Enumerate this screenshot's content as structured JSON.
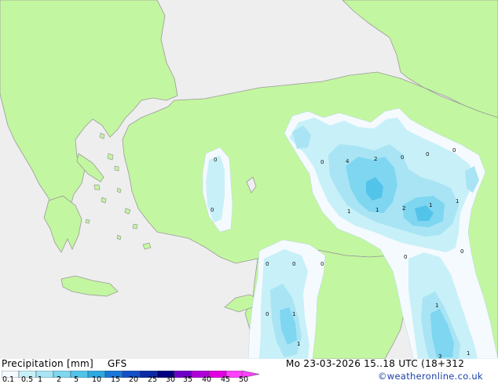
{
  "footer": {
    "title": "Precipitation [mm]",
    "model": "GFS",
    "datetime": "Mo 23-03-2026 15..18 UTC (18+312",
    "credit": "©weatheronline.co.uk"
  },
  "legend": {
    "ticks": [
      "0.1",
      "0.5",
      "1",
      "2",
      "5",
      "10",
      "15",
      "20",
      "25",
      "30",
      "35",
      "40",
      "45",
      "50"
    ],
    "colors": [
      "#f5faff",
      "#c8f0f8",
      "#a8e4f4",
      "#7fd6f0",
      "#52c4ea",
      "#2ea8e0",
      "#1a78d8",
      "#1450c8",
      "#0a2aa8",
      "#000080",
      "#7000c8",
      "#b000d8",
      "#e000e0",
      "#ff40ff"
    ]
  },
  "map_labels": [
    "0",
    "0",
    "0",
    "4",
    "2",
    "0",
    "0",
    "0",
    "1",
    "1",
    "2",
    "1",
    "1",
    "0",
    "0",
    "0",
    "0",
    "0",
    "0",
    "1",
    "1",
    "1",
    "3",
    "1"
  ],
  "palette": {
    "land": "#c3f6a0",
    "sea": "#eeeeee",
    "coast": "#9a9a9a"
  }
}
